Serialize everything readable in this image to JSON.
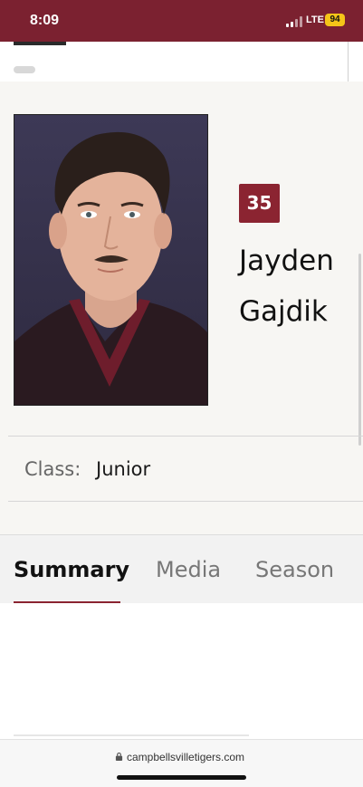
{
  "status_bar": {
    "time": "8:09",
    "network": "LTE",
    "battery": "94",
    "background_color": "#7b2130",
    "battery_color": "#f5c518"
  },
  "player": {
    "number": "35",
    "first_name": "Jayden",
    "last_name": "Gajdik",
    "photo_icon": "player-headshot",
    "accent_color": "#8b2431"
  },
  "details": {
    "class_label": "Class:",
    "class_value": "Junior"
  },
  "tabs": [
    {
      "label": "Summary",
      "active": true
    },
    {
      "label": "Media",
      "active": false
    },
    {
      "label": "Season",
      "active": false
    }
  ],
  "browser": {
    "url": "campbellsvilletigers.com",
    "lock_icon": "lock-icon"
  }
}
